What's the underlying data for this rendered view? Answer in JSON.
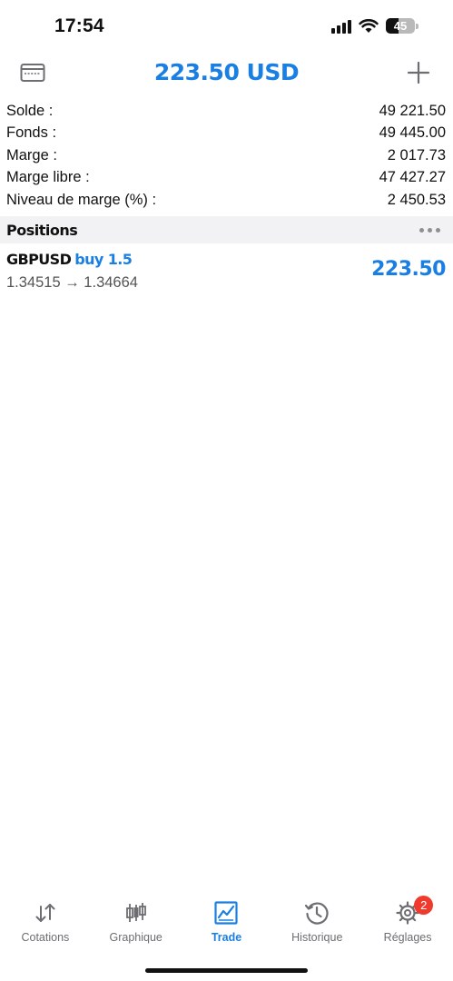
{
  "status_bar": {
    "time": "17:54",
    "battery_level": "45",
    "battery_fraction": 0.45,
    "icons": [
      "signal-icon",
      "wifi-icon",
      "battery-icon"
    ]
  },
  "header": {
    "title": "223.50 USD",
    "left_icon": "account-card-icon",
    "right_icon": "add-icon"
  },
  "summary": {
    "rows": [
      {
        "label": "Solde :",
        "value": "49 221.50"
      },
      {
        "label": "Fonds :",
        "value": "49 445.00"
      },
      {
        "label": "Marge :",
        "value": "2 017.73"
      },
      {
        "label": "Marge libre :",
        "value": "47 427.27"
      },
      {
        "label": "Niveau de marge (%) :",
        "value": "2 450.53"
      }
    ]
  },
  "positions": {
    "section_title": "Positions",
    "items": [
      {
        "symbol": "GBPUSD",
        "side": "buy 1.5",
        "prices": "1.34515 → 1.34664",
        "profit": "223.50"
      }
    ]
  },
  "tab_bar": {
    "tabs": [
      {
        "label": "Cotations",
        "icon": "quotes-arrows-icon"
      },
      {
        "label": "Graphique",
        "icon": "candlestick-chart-icon"
      },
      {
        "label": "Trade",
        "icon": "trade-chart-icon",
        "active": true
      },
      {
        "label": "Historique",
        "icon": "history-clock-icon"
      },
      {
        "label": "Réglages",
        "icon": "settings-gear-icon",
        "badge": "2"
      }
    ]
  },
  "colors": {
    "accent": "#1a7fe3",
    "badge": "#f03a2e",
    "section_bg": "#f2f2f4"
  }
}
